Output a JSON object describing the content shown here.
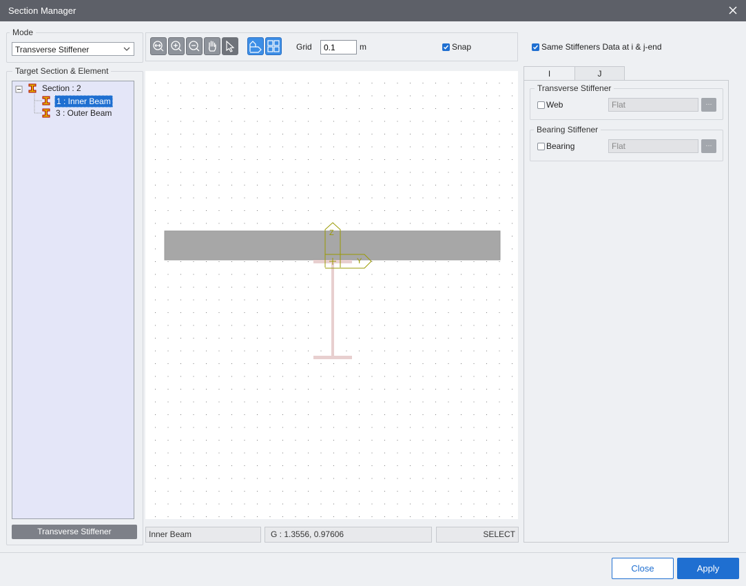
{
  "window": {
    "title": "Section Manager"
  },
  "mode": {
    "label": "Mode",
    "selected": "Transverse Stiffener"
  },
  "target": {
    "label": "Target Section & Element",
    "root": "Section : 2",
    "items": [
      "1 : Inner Beam",
      "3 : Outer Beam"
    ],
    "selected_index": 0
  },
  "left_button": "Transverse Stiffener",
  "toolbar": {
    "icons": [
      "zoom-fit-icon",
      "zoom-in-icon",
      "zoom-out-icon",
      "pan-hand-icon",
      "select-arrow-icon",
      "section-view-icon",
      "grid-view-icon"
    ],
    "grid_label": "Grid",
    "grid_value": "0.1",
    "grid_unit": "m",
    "snap_label": "Snap",
    "snap_checked": true
  },
  "canvas": {
    "axis_z": "Z",
    "axis_y": "Y"
  },
  "status": {
    "element": "Inner Beam",
    "coords": "G : 1.3556, 0.97606",
    "mode": "SELECT"
  },
  "same_data": {
    "label": "Same Stiffeners Data at i & j-end",
    "checked": true
  },
  "tabs": [
    "I",
    "J"
  ],
  "active_tab": 1,
  "transverse": {
    "label": "Transverse Stiffener",
    "check_label": "Web",
    "value": "Flat",
    "more": "..."
  },
  "bearing": {
    "label": "Bearing Stiffener",
    "check_label": "Bearing",
    "value": "Flat",
    "more": "..."
  },
  "footer": {
    "close": "Close",
    "apply": "Apply"
  },
  "colors": {
    "titlebar": "#5d6068",
    "accent": "#1f6fd1",
    "slab": "#a7a7a7",
    "girder": "#e8cfcf",
    "axis": "#9a9a00"
  }
}
